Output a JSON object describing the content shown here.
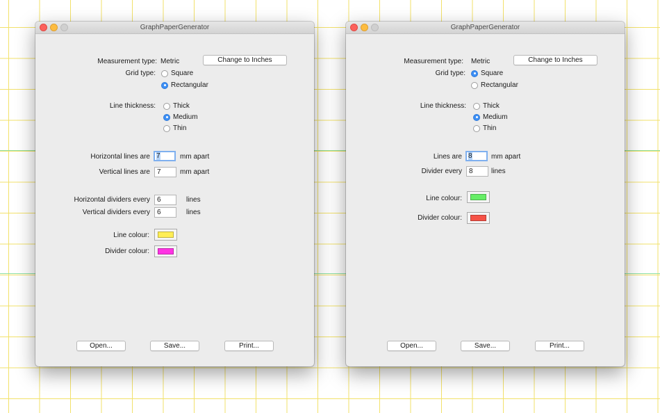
{
  "app_title": "GraphPaperGenerator",
  "colors": {
    "grid_line": "#f2e16a",
    "grid_divider": "#8fe0a0"
  },
  "windows": [
    {
      "title": "GraphPaperGenerator",
      "measurement_label": "Measurement type:",
      "measurement_value": "Metric",
      "change_button": "Change to Inches",
      "grid_type_label": "Grid type:",
      "grid_square": "Square",
      "grid_rectangular": "Rectangular",
      "grid_selected": "Rectangular",
      "line_thickness_label": "Line thickness:",
      "thick": "Thick",
      "medium": "Medium",
      "thin": "Thin",
      "thickness_selected": "Medium",
      "h_lines_label": "Horizontal lines are",
      "h_lines_value": "7",
      "h_lines_suffix": "mm apart",
      "v_lines_label": "Vertical lines are",
      "v_lines_value": "7",
      "v_lines_suffix": "mm apart",
      "h_div_label": "Horizontal dividers every",
      "h_div_value": "6",
      "h_div_suffix": "lines",
      "v_div_label": "Vertical dividers every",
      "v_div_value": "6",
      "v_div_suffix": "lines",
      "line_colour_label": "Line colour:",
      "line_colour": "#ffee55",
      "divider_colour_label": "Divider colour:",
      "divider_colour": "#ff33e3",
      "open": "Open...",
      "save": "Save...",
      "print": "Print..."
    },
    {
      "title": "GraphPaperGenerator",
      "measurement_label": "Measurement type:",
      "measurement_value": "Metric",
      "change_button": "Change to Inches",
      "grid_type_label": "Grid type:",
      "grid_square": "Square",
      "grid_rectangular": "Rectangular",
      "grid_selected": "Square",
      "line_thickness_label": "Line thickness:",
      "thick": "Thick",
      "medium": "Medium",
      "thin": "Thin",
      "thickness_selected": "Medium",
      "lines_label": "Lines are",
      "lines_value": "8",
      "lines_suffix": "mm apart",
      "divider_label": "Divider every",
      "divider_value": "8",
      "divider_suffix": "lines",
      "line_colour_label": "Line colour:",
      "line_colour": "#66ee66",
      "divider_colour_label": "Divider colour:",
      "divider_colour": "#f55247",
      "open": "Open...",
      "save": "Save...",
      "print": "Print..."
    }
  ]
}
